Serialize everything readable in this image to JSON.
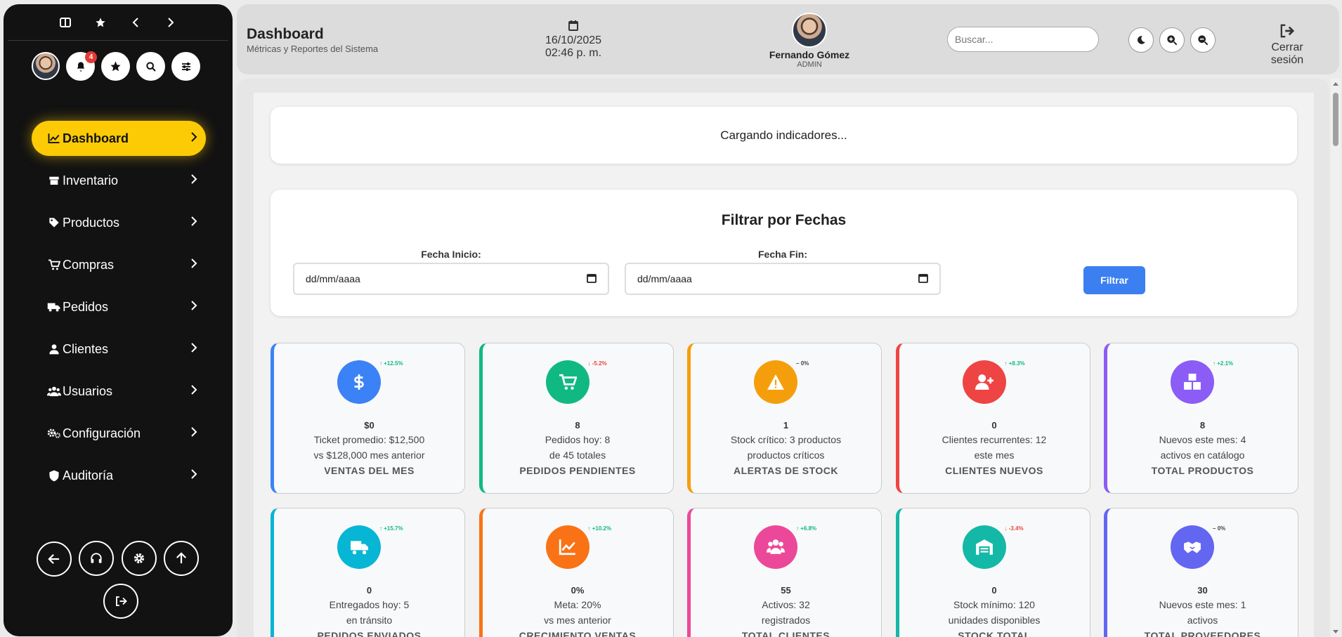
{
  "sidebar": {
    "menu": [
      {
        "id": "dashboard",
        "label": "Dashboard",
        "icon": "chart-line-icon",
        "active": true
      },
      {
        "id": "inventario",
        "label": "Inventario",
        "icon": "box-icon"
      },
      {
        "id": "productos",
        "label": "Productos",
        "icon": "tag-icon"
      },
      {
        "id": "compras",
        "label": "Compras",
        "icon": "cart-icon"
      },
      {
        "id": "pedidos",
        "label": "Pedidos",
        "icon": "truck-icon"
      },
      {
        "id": "clientes",
        "label": "Clientes",
        "icon": "user-icon"
      },
      {
        "id": "usuarios",
        "label": "Usuarios",
        "icon": "users-icon"
      },
      {
        "id": "configuracion",
        "label": "Configuración",
        "icon": "gears-icon"
      },
      {
        "id": "auditoria",
        "label": "Auditoría",
        "icon": "shield-icon"
      }
    ],
    "notification_count": "4",
    "accent": "#fccb05"
  },
  "header": {
    "title": "Dashboard",
    "subtitle": "Métricas y Reportes del Sistema",
    "date": "16/10/2025",
    "time": "02:46 p. m.",
    "user_name": "Fernando Gómez",
    "user_role": "ADMIN",
    "search_placeholder": "Buscar...",
    "logout_label": "Cerrar sesión"
  },
  "loading_text": "Cargando indicadores...",
  "filter": {
    "title": "Filtrar por Fechas",
    "start_label": "Fecha Inicio:",
    "end_label": "Fecha Fin:",
    "start_value": "dd/mm/aaaa",
    "end_value": "dd/mm/aaaa",
    "button_label": "Filtrar",
    "button_color": "#3b7ff0"
  },
  "stats": [
    {
      "name": "ventas-del-mes",
      "color": "#3b82f6",
      "icon": "dollar-icon",
      "trend": "+12.5%",
      "trend_dir": "up",
      "value": "$0",
      "line1": "Ticket promedio: $12,500",
      "line2": "vs $128,000 mes anterior",
      "label": "VENTAS DEL MES"
    },
    {
      "name": "pedidos-pendientes",
      "color": "#10b981",
      "icon": "cart-icon",
      "trend": "-5.2%",
      "trend_dir": "down",
      "value": "8",
      "line1": "Pedidos hoy: 8",
      "line2": "de 45 totales",
      "label": "PEDIDOS PENDIENTES"
    },
    {
      "name": "alertas-de-stock",
      "color": "#f59e0b",
      "icon": "warning-icon",
      "trend": "0%",
      "trend_dir": "flat",
      "value": "1",
      "line1": "Stock crítico: 3 productos",
      "line2": "productos críticos",
      "label": "ALERTAS DE STOCK"
    },
    {
      "name": "clientes-nuevos",
      "color": "#ef4444",
      "icon": "user-plus-icon",
      "trend": "+8.3%",
      "trend_dir": "up",
      "value": "0",
      "line1": "Clientes recurrentes: 12",
      "line2": "este mes",
      "label": "CLIENTES NUEVOS"
    },
    {
      "name": "total-productos",
      "color": "#8b5cf6",
      "icon": "boxes-icon",
      "trend": "+2.1%",
      "trend_dir": "up",
      "value": "8",
      "line1": "Nuevos este mes: 4",
      "line2": "activos en catálogo",
      "label": "TOTAL PRODUCTOS"
    },
    {
      "name": "pedidos-enviados",
      "color": "#06b6d4",
      "icon": "truck-icon",
      "trend": "+15.7%",
      "trend_dir": "up",
      "value": "0",
      "line1": "Entregados hoy: 5",
      "line2": "en tránsito",
      "label": "PEDIDOS ENVIADOS"
    },
    {
      "name": "crecimiento-ventas",
      "color": "#f97316",
      "icon": "chart-line-icon",
      "trend": "+10.2%",
      "trend_dir": "up",
      "value": "0%",
      "line1": "Meta: 20%",
      "line2": "vs mes anterior",
      "label": "CRECIMIENTO VENTAS"
    },
    {
      "name": "total-clientes",
      "color": "#ec4899",
      "icon": "users-icon",
      "trend": "+6.8%",
      "trend_dir": "up",
      "value": "55",
      "line1": "Activos: 32",
      "line2": "registrados",
      "label": "TOTAL CLIENTES"
    },
    {
      "name": "stock-total",
      "color": "#14b8a6",
      "icon": "warehouse-icon",
      "trend": "-3.4%",
      "trend_dir": "down",
      "value": "0",
      "line1": "Stock mínimo: 120",
      "line2": "unidades disponibles",
      "label": "STOCK TOTAL"
    },
    {
      "name": "total-proveedores",
      "color": "#6366f1",
      "icon": "handshake-icon",
      "trend": "0%",
      "trend_dir": "flat",
      "value": "30",
      "line1": "Nuevos este mes: 1",
      "line2": "activos",
      "label": "TOTAL PROVEEDORES"
    }
  ]
}
